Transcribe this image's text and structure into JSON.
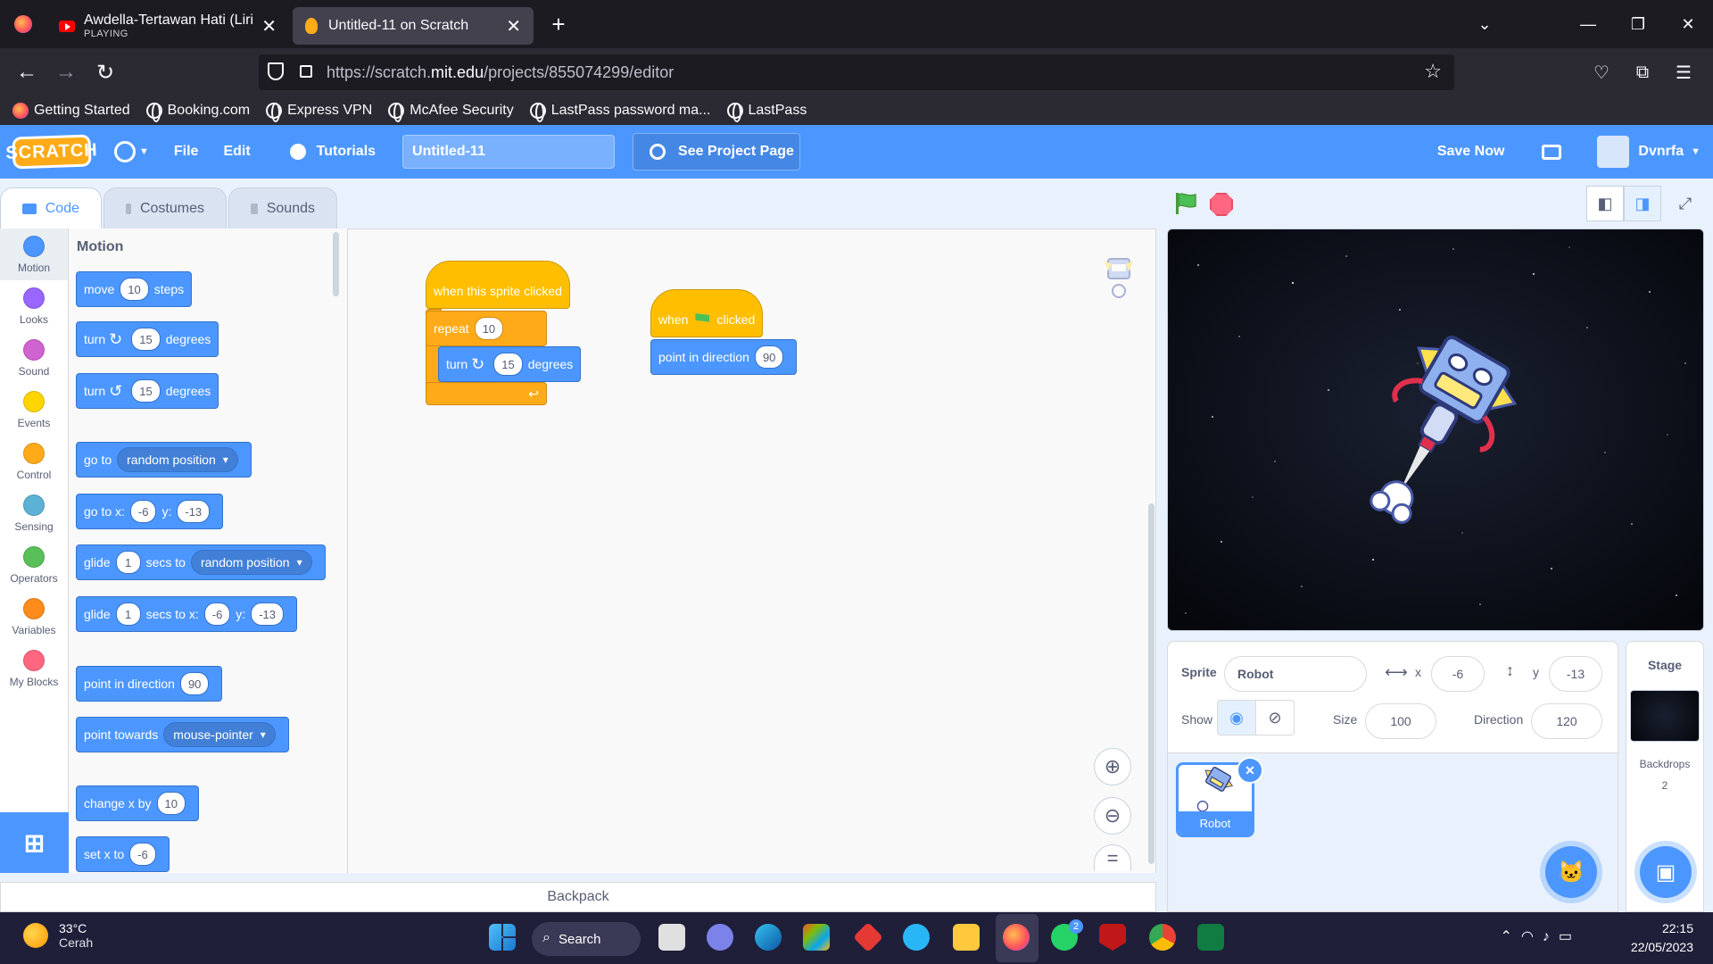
{
  "browser": {
    "tabs": [
      {
        "title": "Awdella-Tertawan Hati (Lirik Lagu)",
        "subtitle": "PLAYING",
        "active": false
      },
      {
        "title": "Untitled-11 on Scratch",
        "subtitle": "",
        "active": true
      }
    ],
    "url_prefix": "https://scratch.",
    "url_domain": "mit.edu",
    "url_path": "/projects/855074299/editor",
    "bookmarks": [
      "Getting Started",
      "Booking.com",
      "Express VPN",
      "McAfee Security",
      "LastPass password ma...",
      "LastPass"
    ]
  },
  "scratch_menu": {
    "logo": "SCRATCH",
    "file": "File",
    "edit": "Edit",
    "tutorials": "Tutorials",
    "project_title": "Untitled-11",
    "see_project_page": "See Project Page",
    "save_now": "Save Now",
    "username": "Dvnrfa"
  },
  "editor_tabs": [
    "Code",
    "Costumes",
    "Sounds"
  ],
  "categories": [
    {
      "label": "Motion",
      "color": "#4c97ff",
      "selected": true
    },
    {
      "label": "Looks",
      "color": "#9966ff"
    },
    {
      "label": "Sound",
      "color": "#cf63cf"
    },
    {
      "label": "Events",
      "color": "#ffd500"
    },
    {
      "label": "Control",
      "color": "#ffab19"
    },
    {
      "label": "Sensing",
      "color": "#5cb1d6"
    },
    {
      "label": "Operators",
      "color": "#59c059"
    },
    {
      "label": "Variables",
      "color": "#ff8c1a"
    },
    {
      "label": "My Blocks",
      "color": "#ff6680"
    }
  ],
  "palette": {
    "heading": "Motion",
    "move": {
      "pre": "move",
      "val": "10",
      "post": "steps"
    },
    "turn_right": {
      "pre": "turn",
      "val": "15",
      "post": "degrees"
    },
    "turn_left": {
      "pre": "turn",
      "val": "15",
      "post": "degrees"
    },
    "goto": {
      "pre": "go to",
      "menu": "random position"
    },
    "goto_xy": {
      "pre": "go to x:",
      "x": "-6",
      "ylabel": "y:",
      "y": "-13"
    },
    "glide_to": {
      "pre": "glide",
      "secs": "1",
      "mid": "secs to",
      "menu": "random position"
    },
    "glide_xy": {
      "pre": "glide",
      "secs": "1",
      "mid": "secs to x:",
      "x": "-6",
      "ylabel": "y:",
      "y": "-13"
    },
    "point_dir": {
      "pre": "point in direction",
      "val": "90"
    },
    "point_towards": {
      "pre": "point towards",
      "menu": "mouse-pointer"
    },
    "change_x": {
      "pre": "change x by",
      "val": "10"
    },
    "set_x": {
      "pre": "set x to",
      "val": "-6"
    }
  },
  "script": {
    "stack1": {
      "hat": "when this sprite clicked",
      "repeat_label": "repeat",
      "repeat_val": "10",
      "turn_pre": "turn",
      "turn_val": "15",
      "turn_post": "degrees"
    },
    "stack2": {
      "hat_pre": "when",
      "hat_post": "clicked",
      "point_pre": "point in direction",
      "point_val": "90"
    }
  },
  "backpack": "Backpack",
  "sprite_info": {
    "sprite_label": "Sprite",
    "sprite_name": "Robot",
    "x_label": "x",
    "x": "-6",
    "y_label": "y",
    "y": "-13",
    "show_label": "Show",
    "size_label": "Size",
    "size": "100",
    "direction_label": "Direction",
    "direction": "120"
  },
  "sprites": [
    {
      "name": "Robot",
      "selected": true
    }
  ],
  "stage_pane": {
    "title": "Stage",
    "backdrops_label": "Backdrops",
    "backdrops_count": "2"
  },
  "taskbar": {
    "temp": "33°C",
    "weather": "Cerah",
    "search": "Search",
    "time": "22:15",
    "date": "22/05/2023",
    "whatsapp_badge": "2"
  }
}
